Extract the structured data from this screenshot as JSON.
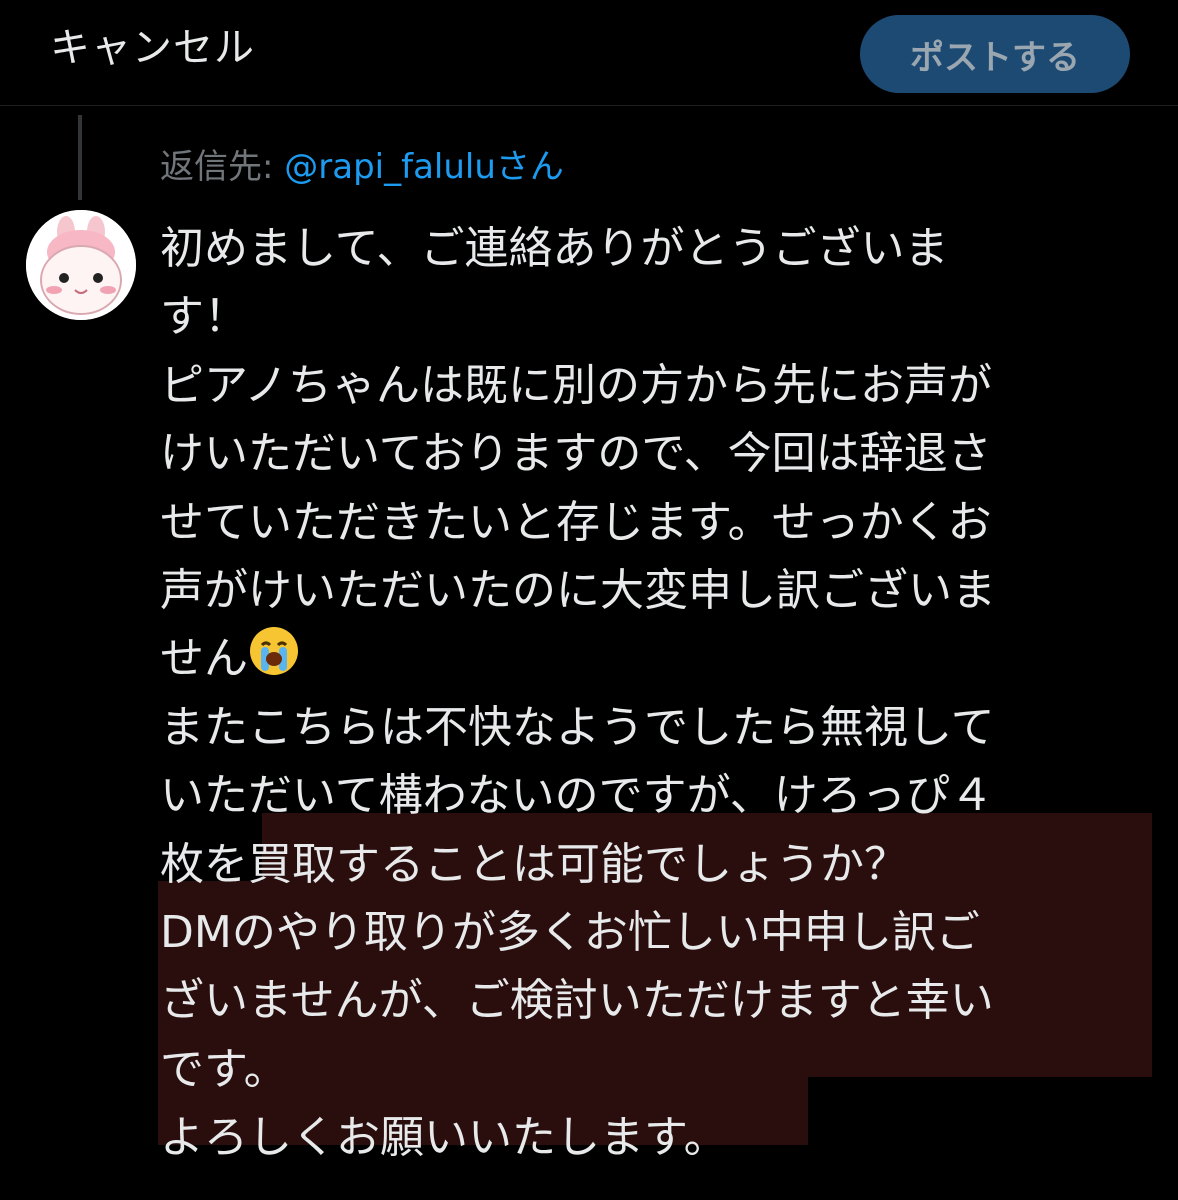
{
  "header": {
    "cancel_label": "キャンセル",
    "post_label": "ポストする"
  },
  "reply": {
    "prefix": "返信先:",
    "handle": "@rapi_falulu",
    "suffix": "さん"
  },
  "message": {
    "lines": [
      "初めまして、ご連絡ありがとうございま",
      "す！",
      "ピアノちゃんは既に別の方から先にお声が",
      "けいただいておりますので、今回は辞退さ",
      "せていただきたいと存じます。せっかくお",
      "声がけいただいたのに大変申し訳ございま",
      "せん",
      "またこちらは不快なようでしたら無視して",
      "いただいて構わないのですが、けろっぴ４",
      "枚を",
      "買取することは可能でしょうか？",
      "DMのやり取りが多くお忙しい中申し訳ご",
      "ざいませんが、ご検討いただけますと幸い",
      "です。",
      "よろしくお願いいたします。"
    ],
    "emoji_name": "loudly-crying-face-emoji"
  },
  "colors": {
    "background": "#000000",
    "text": "#e7e9ea",
    "muted": "#71767b",
    "link": "#1d9bf0",
    "post_button_bg": "#1d4a73",
    "highlight": "#2a0e0e"
  }
}
